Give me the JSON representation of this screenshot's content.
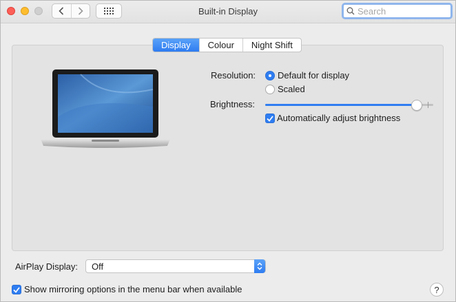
{
  "window": {
    "title": "Built-in Display"
  },
  "toolbar": {
    "back_icon": "chevron-left-icon",
    "forward_icon": "chevron-right-icon",
    "grid_icon": "grid-icon"
  },
  "search": {
    "placeholder": "Search",
    "value": ""
  },
  "tabs": [
    {
      "label": "Display",
      "active": true
    },
    {
      "label": "Colour",
      "active": false
    },
    {
      "label": "Night Shift",
      "active": false
    }
  ],
  "display": {
    "resolution_label": "Resolution:",
    "resolution_options": [
      {
        "label": "Default for display",
        "selected": true
      },
      {
        "label": "Scaled",
        "selected": false
      }
    ],
    "brightness_label": "Brightness:",
    "brightness_level": 0.9,
    "auto_brightness_label": "Automatically adjust brightness",
    "auto_brightness_checked": true
  },
  "airplay": {
    "label": "AirPlay Display:",
    "value": "Off"
  },
  "mirroring": {
    "label": "Show mirroring options in the menu bar when available",
    "checked": true
  },
  "help": {
    "label": "?"
  },
  "colors": {
    "accent": "#2f7df1",
    "close": "#fc5f57",
    "minimize": "#fdbd2e"
  }
}
